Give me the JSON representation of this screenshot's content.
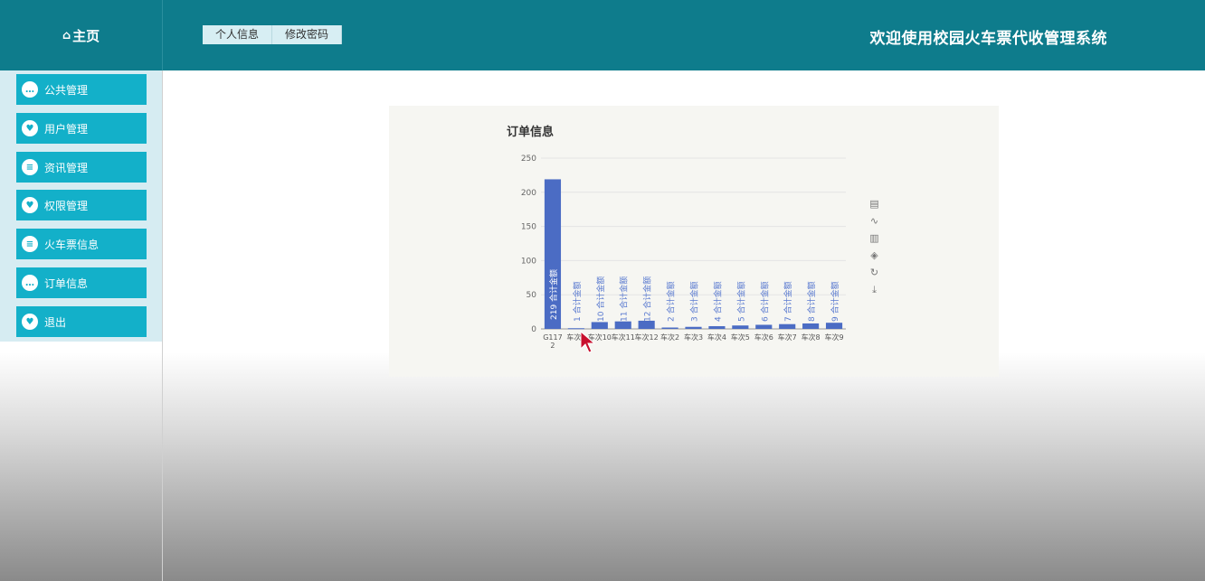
{
  "header": {
    "home_label": "主页",
    "tabs": [
      "个人信息",
      "修改密码"
    ],
    "site_title": "欢迎使用校园火车票代收管理系统"
  },
  "sidebar": {
    "items": [
      {
        "label": "公共管理",
        "icon": "chat-icon"
      },
      {
        "label": "用户管理",
        "icon": "heart-icon"
      },
      {
        "label": "资讯管理",
        "icon": "list-icon"
      },
      {
        "label": "权限管理",
        "icon": "heart-icon"
      },
      {
        "label": "火车票信息",
        "icon": "list-icon"
      },
      {
        "label": "订单信息",
        "icon": "chat-icon"
      },
      {
        "label": "退出",
        "icon": "heart-icon"
      }
    ]
  },
  "colors": {
    "header": "#0e7c8c",
    "menu": "#13b0c9",
    "bar": "#4b6cc4"
  },
  "chart_data": {
    "type": "bar",
    "title": "订单信息",
    "categories": [
      "G1172",
      "车次1",
      "车次10",
      "车次11",
      "车次12",
      "车次2",
      "车次3",
      "车次4",
      "车次5",
      "车次6",
      "车次7",
      "车次8",
      "车次9"
    ],
    "tick_labels": [
      "G117\n2",
      "车次1",
      "车次10",
      "车次11",
      "车次12",
      "车次2",
      "车次3",
      "车次4",
      "车次5",
      "车次6",
      "车次7",
      "车次8",
      "车次9"
    ],
    "values": [
      219,
      1,
      10,
      11,
      12,
      2,
      3,
      4,
      5,
      6,
      7,
      8,
      9
    ],
    "data_label_suffix": "合计金额",
    "ylim": [
      0,
      250
    ],
    "yticks": [
      0,
      50,
      100,
      150,
      200,
      250
    ],
    "grid": true,
    "legend": "none"
  },
  "toolbox": [
    "data-view-icon",
    "line-icon",
    "bar-icon",
    "stack-icon",
    "restore-icon",
    "download-icon"
  ]
}
